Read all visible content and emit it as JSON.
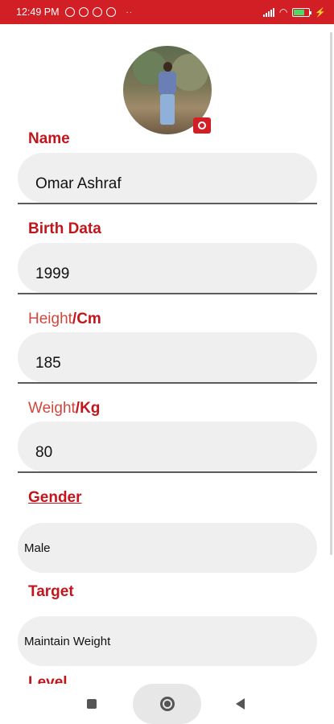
{
  "status_bar": {
    "time": "12:49 PM",
    "dots": "··",
    "battery_fill_fraction": 0.7,
    "colors": {
      "background": "#d21f26"
    }
  },
  "profile": {
    "avatar_icon": "profile-photo",
    "camera_icon": "camera-icon"
  },
  "fields": {
    "name": {
      "label": "Name",
      "value": "Omar Ashraf"
    },
    "birth": {
      "label": "Birth Data",
      "value": "1999"
    },
    "height": {
      "label_light": "Height",
      "label_bold": "/Cm",
      "value": "185"
    },
    "weight": {
      "label_light": "Weight",
      "label_bold": "/Kg",
      "value": "80"
    },
    "gender": {
      "label": "Gender",
      "value": "Male"
    },
    "target": {
      "label": "Target",
      "value": "Maintain Weight"
    },
    "level": {
      "label": "Level"
    }
  },
  "theme": {
    "accent": "#c2161c",
    "field_bg": "#efefef"
  }
}
